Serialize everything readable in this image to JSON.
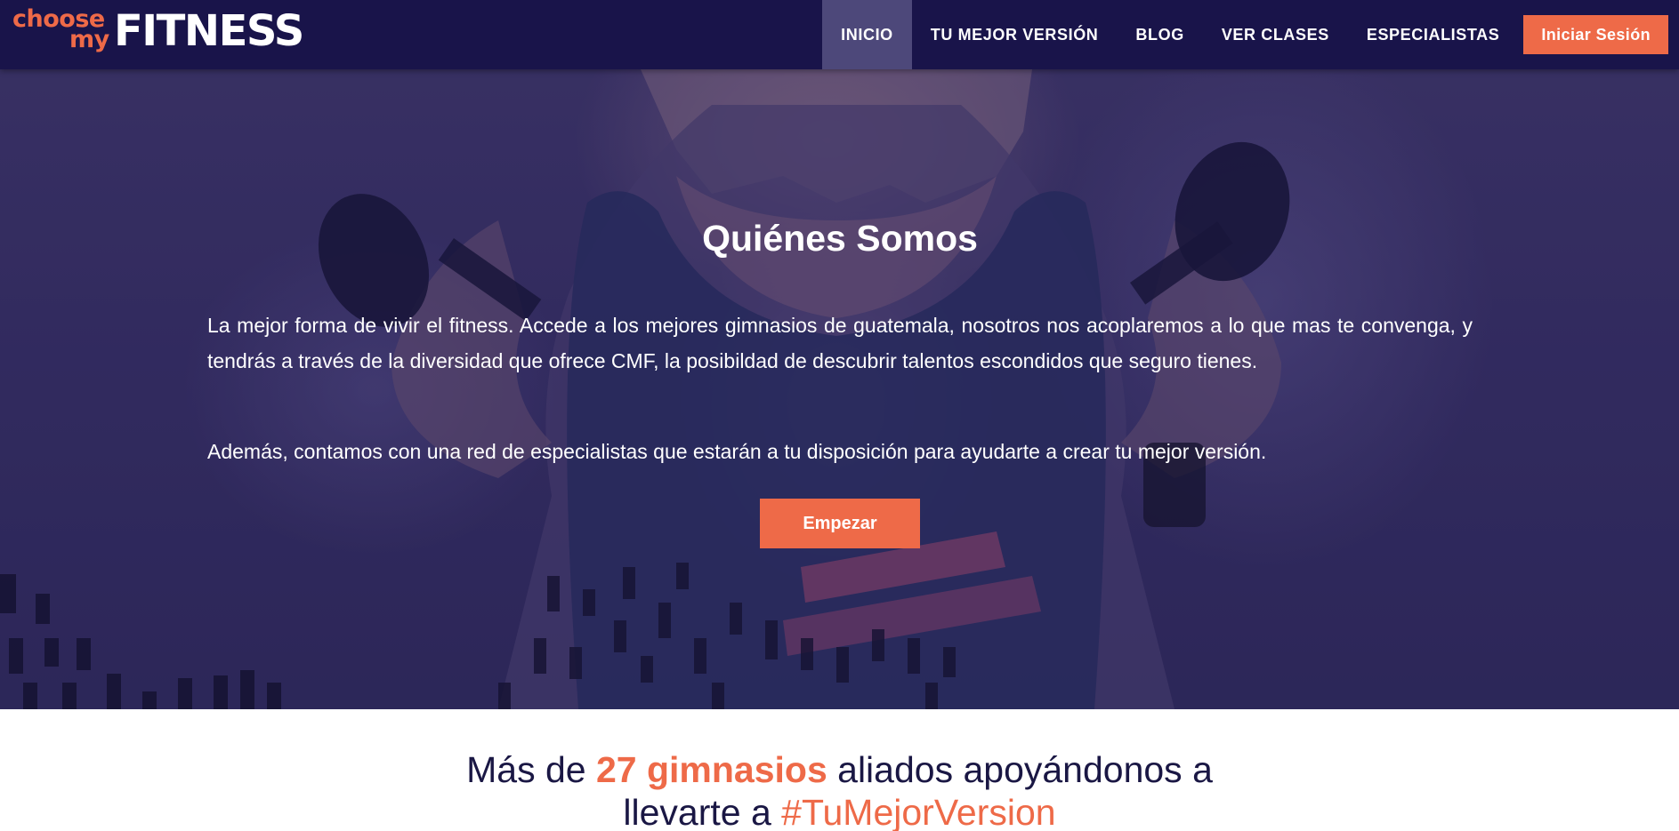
{
  "brand": {
    "logo_choose": "choose",
    "logo_my": "my",
    "logo_fitness": "FITNESS",
    "accent_color": "#ee6a48",
    "navy_color": "#19144a"
  },
  "nav": {
    "items": [
      {
        "label": "INICIO",
        "active": true
      },
      {
        "label": "TU MEJOR VERSIÓN",
        "active": false
      },
      {
        "label": "BLOG",
        "active": false
      },
      {
        "label": "VER CLASES",
        "active": false
      },
      {
        "label": "ESPECIALISTAS",
        "active": false
      }
    ],
    "login_label": "Iniciar Sesión"
  },
  "hero": {
    "title": "Quiénes Somos",
    "paragraph1": "La mejor forma de vivir el fitness. Accede a los mejores gimnasios de guatemala, nosotros nos acoplaremos a lo que mas te convenga, y tendrás a través de la diversidad que ofrece CMF, la posibildad de descubrir talentos escondidos que seguro tienes.",
    "paragraph2": "Además, contamos con una red de especialistas que estarán a tu disposición para ayudarte a crear tu mejor versión.",
    "cta_label": "Empezar"
  },
  "stats": {
    "prefix": "Más de ",
    "highlight": "27 gimnasios",
    "middle": " aliados apoyándonos a",
    "line2_prefix": "llevarte a ",
    "hashtag": "#TuMejorVersion"
  }
}
